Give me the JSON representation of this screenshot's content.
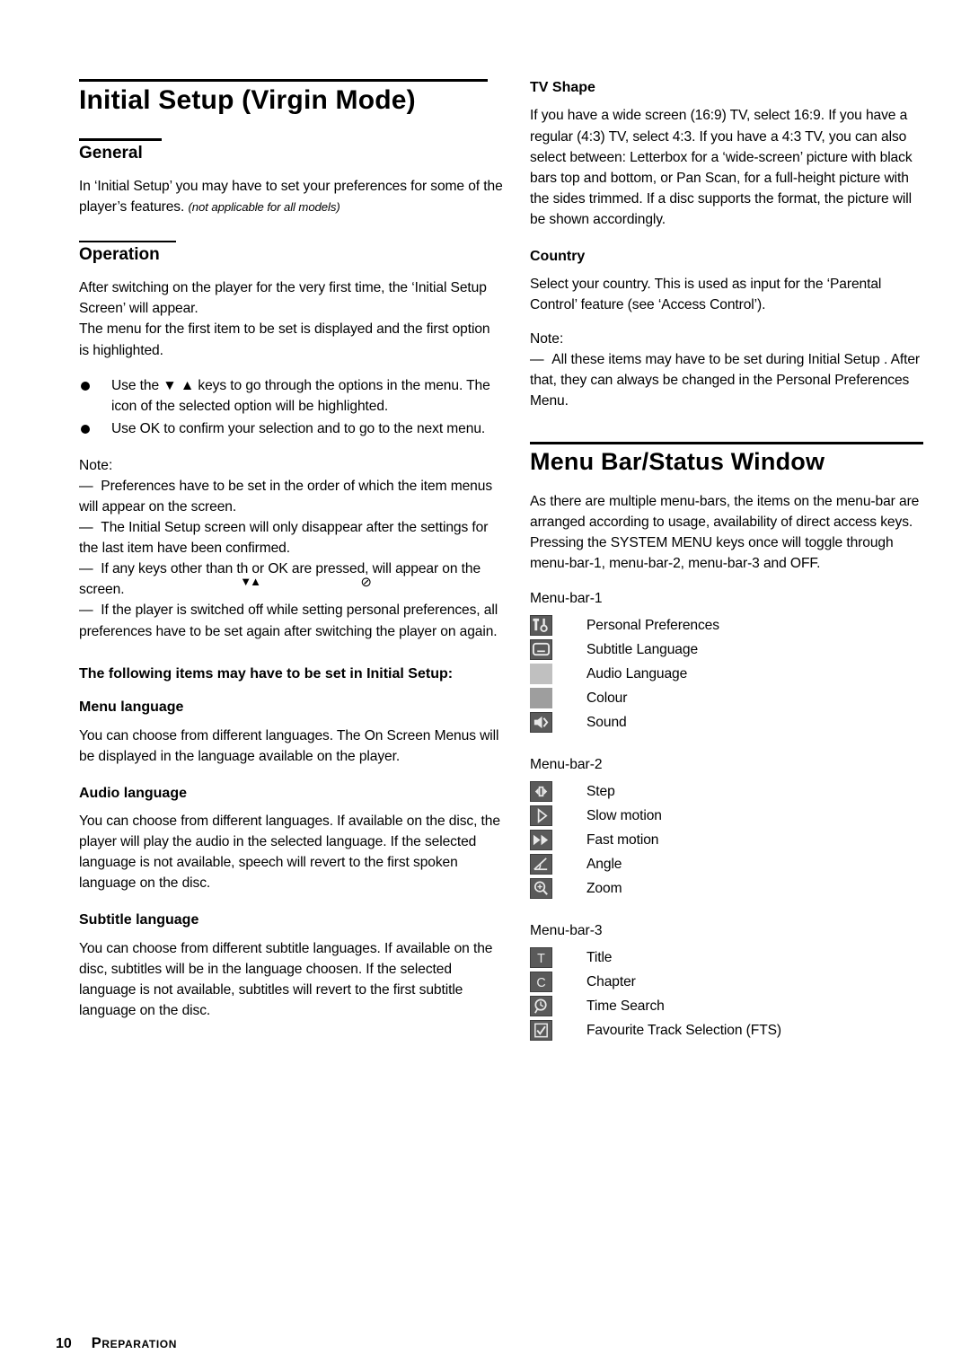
{
  "document": {
    "page_number": "10",
    "footer_section": "Preparation"
  },
  "left_column": {
    "title": "Initial Setup (Virgin Mode)",
    "general": {
      "heading": "General",
      "paragraph": "In ‘Initial Setup’ you may have to set your preferences for some of the player’s features.",
      "note_italic": "(not applicable for all models)"
    },
    "operation": {
      "heading": "Operation",
      "paragraph_1": "After switching on the player for the very first time, the ‘Initial Setup Screen’ will appear.",
      "paragraph_2": "The menu for the first item to be set is displayed and the first option is highlighted.",
      "bullets": [
        "Use the ▼ ▲ keys to go through the options in the menu. The icon of the selected option will be highlighted.",
        "Use OK to confirm your selection and to go to the next menu."
      ],
      "note_label": "Note:",
      "notes": [
        "Preferences have to be set in the order of which the item menus will appear on the screen.",
        "The Initial Setup screen will only disappear after the settings for the last item have been confirmed.",
        "If any keys other than ▼▲ or OK are pressed, ⊘ will appear on the screen.",
        "If the player is switched off while setting personal preferences, all preferences have to be set again after switching the player on again."
      ],
      "note_3_parts": {
        "before": "If any keys other than th",
        "arrows": "▼▲",
        "middle": " or OK are pressed,",
        "symbol": "⊘",
        "after": " will appear on the screen."
      }
    },
    "items_intro": "The following items may have to be set in Initial Setup:",
    "sections": [
      {
        "heading": "Menu language",
        "body": "You can choose from different languages. The On Screen Menus will be displayed in the language available on the player."
      },
      {
        "heading": "Audio language",
        "body": "You can choose from different languages. If available on the disc, the player will play the audio in the selected language. If the selected language is not available, speech will revert to the first spoken language on the disc."
      },
      {
        "heading": "Subtitle language",
        "body": "You can choose from different subtitle languages. If available on the disc, subtitles will be in the language choosen. If the selected language is not available, subtitles will revert to the first subtitle language on the disc."
      }
    ]
  },
  "right_column": {
    "tv_shape": {
      "heading": "TV Shape",
      "body": "If you have a wide screen (16:9) TV, select 16:9. If you have a regular (4:3) TV, select 4:3. If you have a 4:3 TV, you can also select between: Letterbox for a ‘wide-screen’ picture with black bars top and bottom, or Pan Scan, for a full-height picture with the sides trimmed. If a disc supports the format, the picture will be shown accordingly."
    },
    "country": {
      "heading": "Country",
      "body": "Select your country. This is used as input for the ‘Parental Control’ feature (see ‘Access Control’).",
      "note_label": "Note:",
      "note": "All these items may have to be set during Initial Setup . After that, they can always be changed in the Personal Preferences Menu."
    },
    "menu_bar": {
      "title": "Menu Bar/Status Window",
      "intro": "As there are multiple menu-bars, the items on the menu-bar are arranged according to usage, availability of direct access keys. Pressing the SYSTEM MENU keys once will toggle through menu-bar-1, menu-bar-2, menu-bar-3 and OFF.",
      "groups": [
        {
          "label": "Menu-bar-1",
          "items": [
            {
              "icon": "tools-icon",
              "label": "Personal Preferences"
            },
            {
              "icon": "subtitle-icon",
              "label": "Subtitle Language"
            },
            {
              "icon": "audio-language-icon",
              "label": "Audio Language"
            },
            {
              "icon": "colour-icon",
              "label": "Colour"
            },
            {
              "icon": "speaker-icon",
              "label": "Sound"
            }
          ]
        },
        {
          "label": "Menu-bar-2",
          "items": [
            {
              "icon": "step-icon",
              "label": "Step"
            },
            {
              "icon": "slow-motion-icon",
              "label": "Slow motion"
            },
            {
              "icon": "fast-motion-icon",
              "label": "Fast motion"
            },
            {
              "icon": "angle-icon",
              "label": "Angle"
            },
            {
              "icon": "zoom-icon",
              "label": "Zoom"
            }
          ]
        },
        {
          "label": "Menu-bar-3",
          "items": [
            {
              "icon": "title-icon",
              "label": "Title"
            },
            {
              "icon": "chapter-icon",
              "label": "Chapter"
            },
            {
              "icon": "time-search-icon",
              "label": "Time Search"
            },
            {
              "icon": "fts-icon",
              "label": "Favourite Track Selection (FTS)"
            }
          ]
        }
      ]
    }
  }
}
